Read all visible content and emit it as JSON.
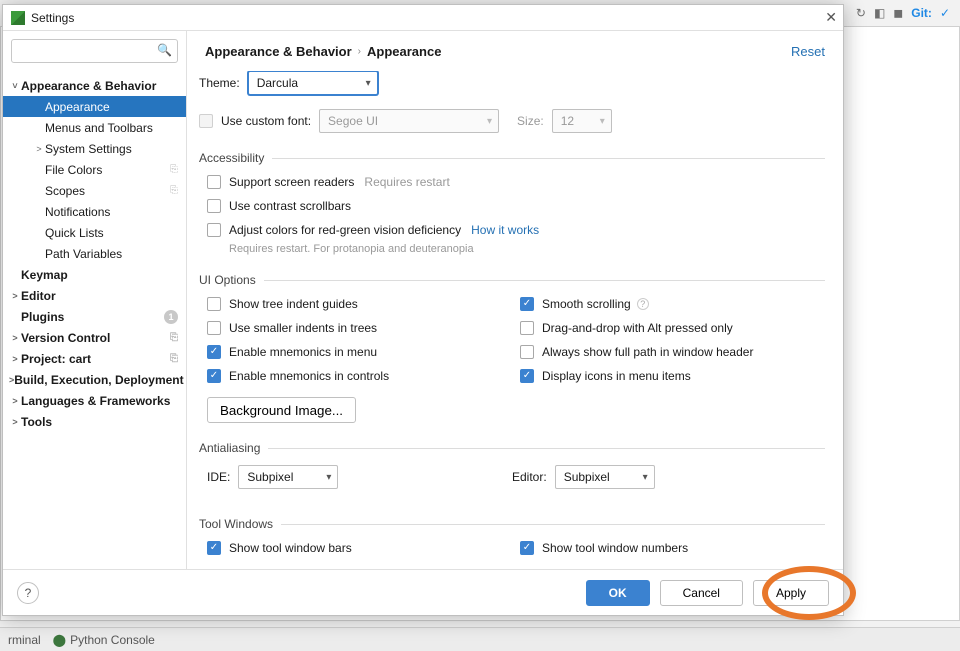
{
  "dialog": {
    "title": "Settings",
    "breadcrumb": {
      "parent": "Appearance & Behavior",
      "current": "Appearance"
    },
    "reset": "Reset"
  },
  "search": {
    "placeholder": ""
  },
  "tree": [
    {
      "label": "Appearance & Behavior",
      "level": 0,
      "expanded": true
    },
    {
      "label": "Appearance",
      "level": 1,
      "selected": true
    },
    {
      "label": "Menus and Toolbars",
      "level": 1
    },
    {
      "label": "System Settings",
      "level": 1,
      "expandable": true
    },
    {
      "label": "File Colors",
      "level": 1,
      "tag": "⎘"
    },
    {
      "label": "Scopes",
      "level": 1,
      "tag": "⎘"
    },
    {
      "label": "Notifications",
      "level": 1
    },
    {
      "label": "Quick Lists",
      "level": 1
    },
    {
      "label": "Path Variables",
      "level": 1
    },
    {
      "label": "Keymap",
      "level": 0
    },
    {
      "label": "Editor",
      "level": 0,
      "expandable": true
    },
    {
      "label": "Plugins",
      "level": 0,
      "badge": "1"
    },
    {
      "label": "Version Control",
      "level": 0,
      "expandable": true,
      "tag": "⎘"
    },
    {
      "label": "Project: cart",
      "level": 0,
      "expandable": true,
      "tag": "⎘"
    },
    {
      "label": "Build, Execution, Deployment",
      "level": 0,
      "expandable": true
    },
    {
      "label": "Languages & Frameworks",
      "level": 0,
      "expandable": true
    },
    {
      "label": "Tools",
      "level": 0,
      "expandable": true
    }
  ],
  "theme": {
    "label": "Theme:",
    "value": "Darcula"
  },
  "custom_font": {
    "checkbox": "Use custom font:",
    "font_value": "Segoe UI",
    "size_label": "Size:",
    "size_value": "12"
  },
  "sections": {
    "accessibility": {
      "title": "Accessibility",
      "screen_readers": "Support screen readers",
      "screen_readers_hint": "Requires restart",
      "contrast": "Use contrast scrollbars",
      "colorblind": "Adjust colors for red-green vision deficiency",
      "colorblind_link": "How it works",
      "colorblind_hint": "Requires restart. For protanopia and deuteranopia"
    },
    "ui": {
      "title": "UI Options",
      "tree_indent": "Show tree indent guides",
      "smaller_indent": "Use smaller indents in trees",
      "mnemonics_menu": "Enable mnemonics in menu",
      "mnemonics_ctrl": "Enable mnemonics in controls",
      "smooth": "Smooth scrolling",
      "dnd_alt": "Drag-and-drop with Alt pressed only",
      "full_path": "Always show full path in window header",
      "icons_menu": "Display icons in menu items",
      "bg_image": "Background Image..."
    },
    "aa": {
      "title": "Antialiasing",
      "ide_label": "IDE:",
      "ide_value": "Subpixel",
      "editor_label": "Editor:",
      "editor_value": "Subpixel"
    },
    "tw": {
      "title": "Tool Windows",
      "bars": "Show tool window bars",
      "numbers": "Show tool window numbers"
    }
  },
  "buttons": {
    "ok": "OK",
    "cancel": "Cancel",
    "apply": "Apply"
  },
  "ide_bottom": {
    "terminal": "rminal",
    "python": "Python Console"
  },
  "ide_toolbar": {
    "git": "Git:"
  }
}
